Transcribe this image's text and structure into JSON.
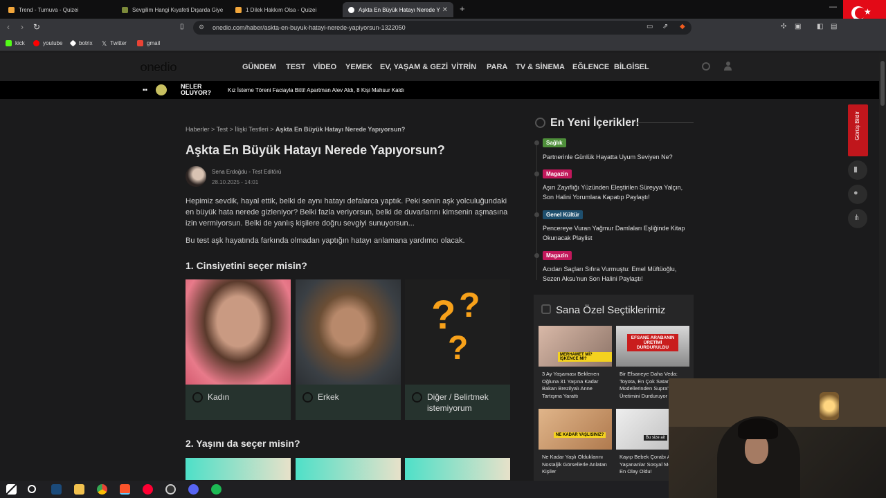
{
  "browser": {
    "tabs": [
      {
        "title": "Trend - Turnuva - Quizei",
        "favicon_color": "#f2a63b"
      },
      {
        "title": "Sevgilim Hangi Kıyafeti Dışarda Giye",
        "favicon_color": "#7c8a3a"
      },
      {
        "title": "1 Dilek Hakkım Olsa - Quizei",
        "favicon_color": "#f2a63b"
      },
      {
        "title": "Aşkta En Büyük Hatayı Nerede Y",
        "favicon_color": "#ffffff"
      }
    ],
    "url": "onedio.com/haber/askta-en-buyuk-hatayi-nerede-yapiyorsun-1322050",
    "bookmarks": [
      {
        "label": "kick",
        "color": "#53fc18"
      },
      {
        "label": "youtube",
        "color": "#ff0000"
      },
      {
        "label": "botrix",
        "color": "#ffffff"
      },
      {
        "label": "Twitter",
        "color": "#dddddd"
      },
      {
        "label": "gmail",
        "color": "#ea4335"
      }
    ]
  },
  "site": {
    "logo": "onedio",
    "nav": [
      "GÜNDEM",
      "TEST",
      "VİDEO",
      "YEMEK",
      "EV, YAŞAM & GEZİ",
      "VİTRİN",
      "PARA",
      "TV & SİNEMA",
      "EĞLENCE",
      "BİLGİSEL"
    ],
    "ticker_label": "NELER OLUYOR?",
    "ticker_news": "Kız İsteme Töreni Faciayla Bitti! Apartman Alev Aldı, 8 Kişi Mahsur Kaldı"
  },
  "article": {
    "breadcrumb": [
      "Haberler",
      "Test",
      "İlişki Testleri"
    ],
    "breadcrumb_current": "Aşkta En Büyük Hatayı Nerede Yapıyorsun?",
    "title": "Aşkta En Büyük Hatayı Nerede Yapıyorsun?",
    "author": "Sena Erdoğdu",
    "author_role": "Test Editörü",
    "date": "28.10.2025 - 14:01",
    "intro": "Hepimiz sevdik, hayal ettik, belki de aynı hatayı defalarca yaptık. Peki senin aşk yolculuğundaki en büyük hata nerede gizleniyor? Belki fazla veriyorsun, belki de duvarlarını kimsenin aşmasına izin vermiyorsun. Belki de yanlış kişilere doğru sevgiyi sunuyorsun...",
    "intro2": "Bu test aşk hayatında farkında olmadan yaptığın hatayı anlamana yardımcı olacak.",
    "q1": "1. Cinsiyetini seçer misin?",
    "q1_options": [
      "Kadın",
      "Erkek",
      "Diğer / Belirtmek istemiyorum"
    ],
    "q2": "2. Yaşını da seçer misin?"
  },
  "sidebar": {
    "heading": "En Yeni İçerikler!",
    "items": [
      {
        "category": "Sağlık",
        "color": "#4e8f3a",
        "title": "Partnerinle Günlük Hayatta Uyum Seviyen Ne?"
      },
      {
        "category": "Magazin",
        "color": "#c2185b",
        "title": "Aşırı Zayıflığı Yüzünden Eleştirilen Süreyya Yalçın, Son Halini Yorumlara Kapatıp Paylaştı!"
      },
      {
        "category": "Genel Kültür",
        "color": "#1e4f6e",
        "title": "Pencereye Vuran Yağmur Damlaları Eşliğinde Kitap Okunacak Playlist"
      },
      {
        "category": "Magazin",
        "color": "#c2185b",
        "title": "Acıdan Saçları Sıfıra Vurmuştu: Emel Müftüoğlu, Sezen Aksu'nun Son Halini Paylaştı!"
      }
    ],
    "special_heading": "Sana Özel Seçtiklerimiz",
    "cards": [
      {
        "title": "3 Ay Yaşaması Beklenen Oğluna 31 Yaşına Kadar Bakan Brezilyalı Anne Tartışma Yarattı",
        "overlay": "MERHAMET Mİ? İŞKENCE Mİ?"
      },
      {
        "title": "Bir Efsaneye Daha Veda: Toyota, En Çok Satan Modellerinden Supra'nın Üretimini Durduruyor",
        "overlay": "EFSANE ARABANIN ÜRETİMİ DURDURULDU"
      },
      {
        "title": "Ne Kadar Yaşlı Olduklarını Nostaljik Görsellerle Anlatan Kişiler",
        "overlay": "NE KADAR YAŞLISINIZ?"
      },
      {
        "title": "Kayıp Bebek Çorabı Ardından Yaşananlar Sosyal Medyanın En Olay Oldu!",
        "overlay": "Bu size ait"
      }
    ],
    "feedback": "Görüş Bildir"
  }
}
